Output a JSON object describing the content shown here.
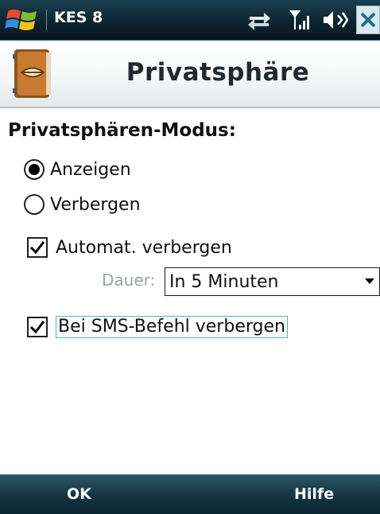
{
  "statusbar": {
    "app_name": "KES 8",
    "icons": [
      "windows-start-icon",
      "connectivity-icon",
      "signal-strength-icon",
      "volume-icon",
      "close-icon"
    ]
  },
  "header": {
    "title": "Privatsphäre",
    "icon": "privacy-book-icon"
  },
  "privacy_mode": {
    "heading": "Privatsphären-Modus:",
    "options": [
      {
        "label": "Anzeigen",
        "selected": true
      },
      {
        "label": "Verbergen",
        "selected": false
      }
    ]
  },
  "auto_hide": {
    "label": "Automat. verbergen",
    "checked": true,
    "duration_label": "Dauer:",
    "duration_value": "In 5 Minuten"
  },
  "sms_hide": {
    "label": "Bei SMS-Befehl verbergen",
    "checked": true
  },
  "softkeys": {
    "left": "OK",
    "right": "Hilfe"
  },
  "colors": {
    "statusbar": "#0c2430",
    "softbar": "#143644",
    "focus_border": "#4cb6c9"
  }
}
